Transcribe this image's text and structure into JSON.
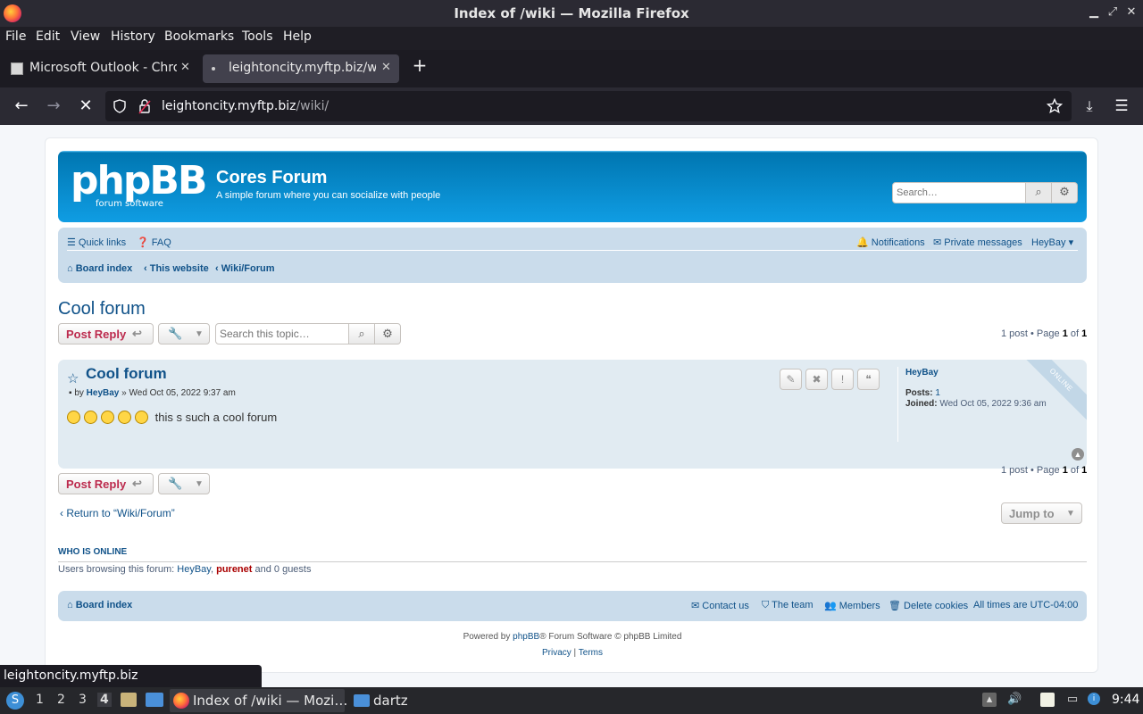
{
  "window": {
    "title": "Index of /wiki — Mozilla Firefox"
  },
  "menu": [
    "File",
    "Edit",
    "View",
    "History",
    "Bookmarks",
    "Tools",
    "Help"
  ],
  "tabs": [
    {
      "label": "Microsoft Outlook - Chrome",
      "active": false
    },
    {
      "label": "leightoncity.myftp.biz/wiki/",
      "active": true
    }
  ],
  "urlbar": {
    "host": "leightoncity.myftp.biz",
    "path": "/wiki/"
  },
  "forum": {
    "site_name": "Cores Forum",
    "site_desc": "A simple forum where you can socialize with people",
    "logo_text": "phpBB",
    "logo_sub": "forum   software",
    "search_placeholder": "Search…",
    "quick_links": "Quick links",
    "faq": "FAQ",
    "notifications": "Notifications",
    "private_messages": "Private messages",
    "username": "HeyBay",
    "breadcrumbs": [
      "Board index",
      "This website",
      "Wiki/Forum"
    ],
    "topic_title": "Cool forum",
    "post_reply": "Post Reply",
    "topic_search_placeholder": "Search this topic…",
    "pagination": {
      "prefix": "1 post • Page ",
      "page": "1",
      "mid": " of ",
      "total": "1"
    },
    "post": {
      "title": "Cool forum",
      "by": "by",
      "author": "HeyBay",
      "date": "» Wed Oct 05, 2022 9:37 am",
      "text": "this s such a cool forum",
      "smiley_count": 5,
      "online_label": "ONLINE",
      "profile": {
        "name": "HeyBay",
        "posts_label": "Posts:",
        "posts": "1",
        "joined_label": "Joined:",
        "joined": "Wed Oct 05, 2022 9:36 am"
      }
    },
    "return_link": "Return to “Wiki/Forum”",
    "jump_to": "Jump to",
    "who_is_online": {
      "heading": "WHO IS ONLINE",
      "prefix": "Users browsing this forum: ",
      "user1": "HeyBay",
      "sep": ", ",
      "user2": "purenet",
      "suffix": " and 0 guests"
    },
    "footer": {
      "board_index": "Board index",
      "contact": "Contact us",
      "team": "The team",
      "members": "Members",
      "delete_cookies": "Delete cookies",
      "timezone": "All times are UTC-04:00",
      "powered_prefix": "Powered by ",
      "powered_link": "phpBB",
      "powered_suffix": "® Forum Software © phpBB Limited",
      "privacy": "Privacy",
      "terms": "Terms",
      "divider": " | "
    }
  },
  "status_link": "leightoncity.myftp.biz",
  "taskbar": {
    "workspaces": [
      "1",
      "2",
      "3",
      "4"
    ],
    "active_workspace": "4",
    "tasks": [
      {
        "label": "Index of /wiki — Mozi…",
        "active": true
      },
      {
        "label": "dartz",
        "active": false
      }
    ],
    "clock": "9:44"
  }
}
